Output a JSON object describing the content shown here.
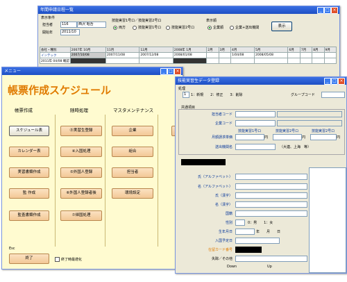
{
  "win1": {
    "title": "年間申請日程一覧",
    "group_label": "表示条件",
    "code_label": "担当者",
    "code_value": "116",
    "name_value": "西沢 昭吾",
    "year_label": "開始年",
    "year_value": "2011/10",
    "radio_group_title": "技能実習1号ロ／技能実習2号ロ",
    "radio_all": "両方",
    "radio_1": "技能実習1号ロ",
    "radio_2": "技能実習2号ロ",
    "display_title": "表示順",
    "display_opt1": "企業順",
    "display_opt2": "企業+送出機関",
    "show_button": "表示",
    "header_cells": [
      "会社・種別",
      "2007年\n10月",
      "11月",
      "12月",
      "2008年\n1月",
      "2月",
      "3月",
      "4月",
      "5月",
      "6月",
      "7月",
      "8月",
      "9月"
    ],
    "row1": [
      "インテック",
      "2011年\n04/08 確認",
      "2007/10/08",
      "2007/11/08",
      "2007/12/08",
      "2008/01/08",
      "",
      "",
      "1/04/08",
      "2008/05/08",
      "",
      "",
      "",
      ""
    ],
    "row1b": [
      "",
      "",
      "",
      "",
      "",
      "",
      "",
      "",
      "",
      "",
      "",
      "",
      "",
      ""
    ]
  },
  "win2": {
    "title": "メニュー",
    "heading": "帳票作成スケジュール",
    "col1_title": "帳票作成",
    "col2_title": "随時処理",
    "col3_title": "マスタメンテナンス",
    "col1": [
      "スケジュール表",
      "カレンダー表",
      "実習書類作成",
      "監 作成",
      "監査書類作成"
    ],
    "col2": [
      "⓪実習生登録",
      "④入国処理",
      "⑤外国人登録",
      "⑥外国人登録者後",
      "⑦帰国処理"
    ],
    "col3": [
      "企業",
      "組合",
      "担当者",
      "環境設定"
    ],
    "esc_label": "Esc",
    "exit_button": "終了",
    "exit_check_label": "終了時最適化"
  },
  "win3": {
    "title": "技能実習生データ登録",
    "process_label": "処理",
    "process_value": "1",
    "process_opts": "1：新規　　2：修正　　3：削除",
    "group_code_label": "グループコード",
    "common_label": "共通項目",
    "labels_top": [
      "担当者コード",
      "企業コード",
      "月額請求単価",
      "送出機関名"
    ],
    "col_header1": "技能実習1号ロ",
    "col_header2": "技能実習2号ロ",
    "col_header3": "技能実習2号ロ",
    "yen": "円",
    "example": "（大連、上海　等）",
    "labels_bottom": [
      "氏（アルファベット）",
      "名（アルファベット）",
      "氏（漢字）",
      "名（漢字）",
      "国籍",
      "性別",
      "生年月日",
      "入国予定日",
      "在留カード番号",
      "失踪／その他"
    ],
    "gender_opts": "0：男　　1：女",
    "dob_units": "年　　月　　日",
    "nav_down": "Down",
    "nav_up": "Up"
  }
}
